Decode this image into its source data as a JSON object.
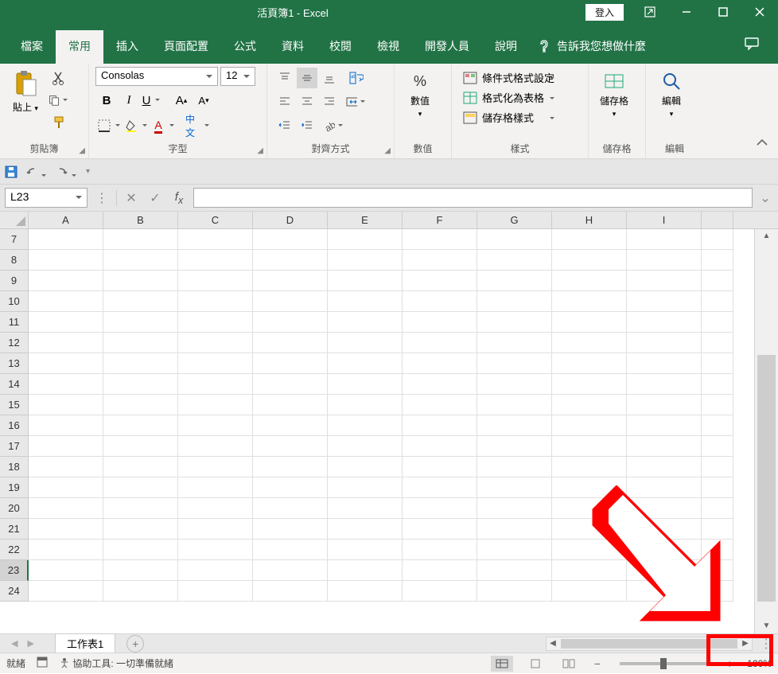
{
  "title": "活頁簿1 - Excel",
  "login": "登入",
  "tabs": {
    "file": "檔案",
    "home": "常用",
    "insert": "插入",
    "layout": "頁面配置",
    "formulas": "公式",
    "data": "資料",
    "review": "校閱",
    "view": "檢視",
    "developer": "開發人員",
    "help": "說明",
    "tellme": "告訴我您想做什麼"
  },
  "ribbon": {
    "clipboard": {
      "label": "剪貼簿",
      "paste": "貼上"
    },
    "font": {
      "label": "字型",
      "name": "Consolas",
      "size": "12"
    },
    "align": {
      "label": "對齊方式"
    },
    "number": {
      "label": "數值",
      "btn": "數值"
    },
    "styles": {
      "label": "樣式",
      "conditional": "條件式格式設定",
      "astable": "格式化為表格",
      "cellstyles": "儲存格樣式"
    },
    "cells": {
      "label": "儲存格",
      "btn": "儲存格"
    },
    "editing": {
      "label": "編輯",
      "btn": "編輯"
    }
  },
  "namebox": "L23",
  "columns": [
    "A",
    "B",
    "C",
    "D",
    "E",
    "F",
    "G",
    "H",
    "I"
  ],
  "rows": [
    7,
    8,
    9,
    10,
    11,
    12,
    13,
    14,
    15,
    16,
    17,
    18,
    19,
    20,
    21,
    22,
    23,
    24
  ],
  "selected_row": 23,
  "sheet": {
    "name": "工作表1"
  },
  "status": {
    "ready": "就緒",
    "accessibility": "協助工具: 一切準備就緒",
    "zoom": "100%"
  }
}
